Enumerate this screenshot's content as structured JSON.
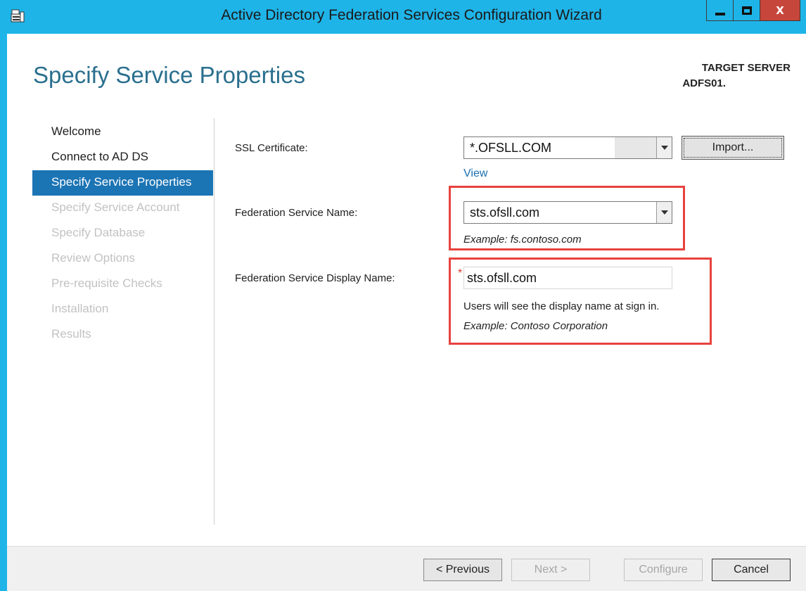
{
  "window": {
    "title": "Active Directory Federation Services Configuration Wizard",
    "icons": {
      "app": "server-wizard-icon",
      "minimize": "minimize-icon",
      "maximize": "maximize-icon",
      "close": "close-icon"
    },
    "close_glyph": "X"
  },
  "header": {
    "page_title": "Specify Service Properties",
    "target_label": "TARGET SERVER",
    "target_value": "ADFS01."
  },
  "nav": {
    "items": [
      {
        "label": "Welcome",
        "state": "done"
      },
      {
        "label": "Connect to AD DS",
        "state": "done"
      },
      {
        "label": "Specify Service Properties",
        "state": "active"
      },
      {
        "label": "Specify Service Account",
        "state": "disabled"
      },
      {
        "label": "Specify Database",
        "state": "disabled"
      },
      {
        "label": "Review Options",
        "state": "disabled"
      },
      {
        "label": "Pre-requisite Checks",
        "state": "disabled"
      },
      {
        "label": "Installation",
        "state": "disabled"
      },
      {
        "label": "Results",
        "state": "disabled"
      }
    ]
  },
  "form": {
    "ssl": {
      "label": "SSL Certificate:",
      "value": "*.OFSLL.COM",
      "import_label": "Import...",
      "view_label": "View"
    },
    "fs_name": {
      "label": "Federation Service Name:",
      "value": "sts.ofsll.com",
      "example": "Example: fs.contoso.com"
    },
    "display_name": {
      "label": "Federation Service Display Name:",
      "required_mark": "*",
      "value": "sts.ofsll.com",
      "hint": "Users will see the display name at sign in.",
      "example": "Example: Contoso Corporation"
    }
  },
  "footer": {
    "previous": "< Previous",
    "next": "Next >",
    "configure": "Configure",
    "cancel": "Cancel"
  },
  "colors": {
    "accent": "#1b74b4",
    "frame": "#1fb4e8",
    "highlight": "#e8423e",
    "title": "#2a6f8e"
  }
}
